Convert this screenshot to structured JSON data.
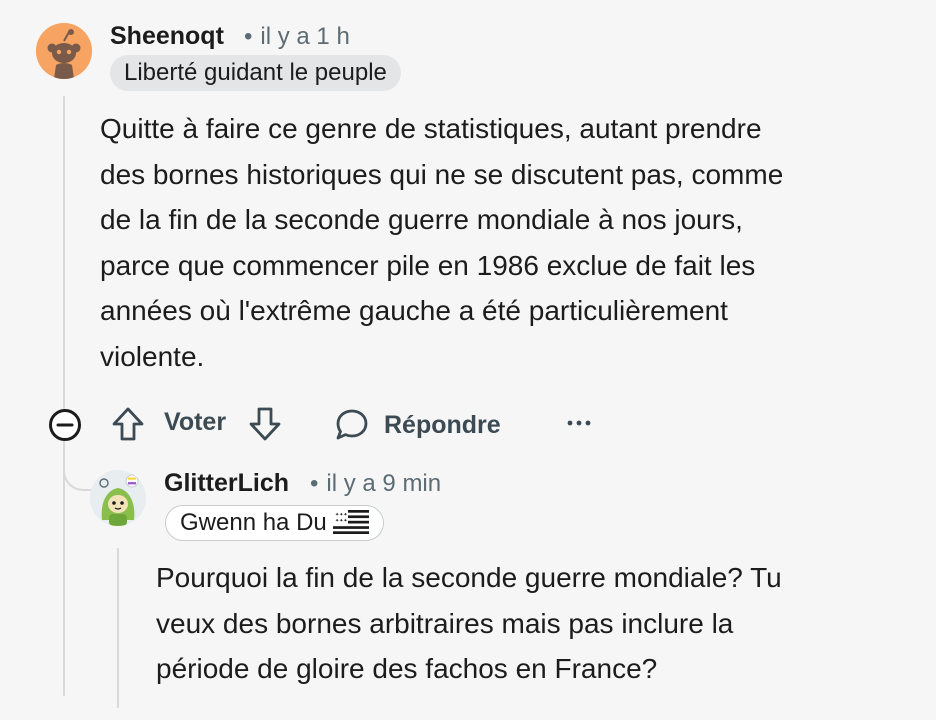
{
  "comments": [
    {
      "author": "Sheenoqt",
      "timestamp": "il y a 1 h",
      "flair": "Liberté guidant le peuple",
      "avatar": "snoo-avatar-orange",
      "body_lines": [
        "Quitte à faire ce genre de statistiques, autant prendre",
        "des bornes historiques qui ne se discutent pas, comme",
        "de la fin de la seconde guerre mondiale à nos jours,",
        "parce que commencer pile en 1986 exclue de fait les",
        "années où l'extrême gauche a été particulièrement",
        "violente."
      ]
    },
    {
      "author": "GlitterLich",
      "timestamp": "il y a 9 min",
      "flair": "Gwenn ha Du",
      "avatar": "snoo-avatar-green-hood",
      "body_lines": [
        "Pourquoi la fin de la seconde guerre mondiale? Tu",
        "veux des bornes arbitraires mais pas inclure la",
        "période de gloire des fachos en France?"
      ]
    }
  ],
  "actions": {
    "collapse_icon": "minus-circle-icon",
    "upvote_icon": "arrow-up-icon",
    "vote_label": "Voter",
    "downvote_icon": "arrow-down-icon",
    "reply_icon": "speech-bubble-icon",
    "reply_label": "Répondre",
    "more_icon": "ellipsis-icon"
  },
  "separator": "•",
  "colors": {
    "background": "#f6f6f6",
    "text": "#1c1c1c",
    "meta": "#5c6c74",
    "action": "#3c4a53",
    "flair_bg": "#e3e5e7",
    "avatar_1": "#f7a361"
  }
}
